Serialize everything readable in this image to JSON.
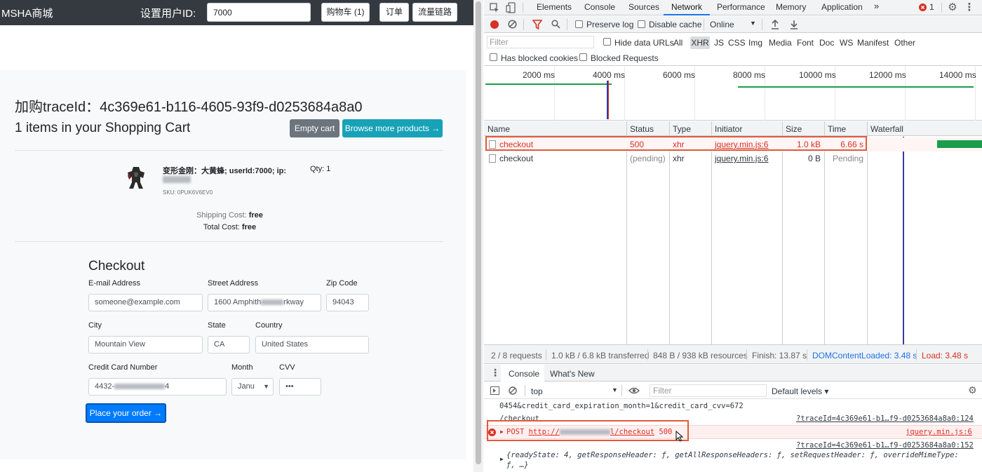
{
  "app": {
    "brand": "MSHA商城",
    "user_id_label": "设置用户ID:",
    "user_id_value": "7000",
    "cart_button": "购物车 (1)",
    "orders_button": "订单",
    "trace_button": "流量链路",
    "trace_id_text": "加购traceId：4c369e61-b116-4605-93f9-d0253684a8a0",
    "cart_count_text": "1 items in your Shopping Cart",
    "empty_cart_button": "Empty cart",
    "browse_button": "Browse more products →",
    "product": {
      "name": "变形金刚：大黄蜂; userId:7000; ip:",
      "sku": "SKU: 0PUK6V6EV0",
      "qty": "Qty: 1"
    },
    "shipping_label": "Shipping Cost: ",
    "shipping_value": "free",
    "total_label": "Total Cost: ",
    "total_value": "free",
    "checkout": {
      "title": "Checkout",
      "email_label": "E-mail Address",
      "email_value": "someone@example.com",
      "street_label": "Street Address",
      "street_value_a": "1600 Amphith",
      "street_value_b": "rkway",
      "zip_label": "Zip Code",
      "zip_value": "94043",
      "city_label": "City",
      "city_value": "Mountain View",
      "state_label": "State",
      "state_value": "CA",
      "country_label": "Country",
      "country_value": "United States",
      "cc_label": "Credit Card Number",
      "cc_value_a": "4432-",
      "cc_value_b": "4",
      "month_label": "Month",
      "month_value": "Janu",
      "cvv_label": "CVV",
      "cvv_value": "•••",
      "place_order": "Place your order →"
    }
  },
  "devtools": {
    "tabs": [
      "Elements",
      "Console",
      "Sources",
      "Network",
      "Performance",
      "Memory",
      "Application"
    ],
    "more_tabs": "»",
    "error_count": "1",
    "toolbar": {
      "preserve_log": "Preserve log",
      "disable_cache": "Disable cache",
      "throttle": "Online"
    },
    "filter": {
      "placeholder": "Filter",
      "hide_data_urls": "Hide data URLs",
      "types": [
        "All",
        "XHR",
        "JS",
        "CSS",
        "Img",
        "Media",
        "Font",
        "Doc",
        "WS",
        "Manifest",
        "Other"
      ],
      "active_type": "XHR",
      "has_blocked_cookies": "Has blocked cookies",
      "blocked_requests": "Blocked Requests"
    },
    "timeline_ticks": [
      "2000 ms",
      "4000 ms",
      "6000 ms",
      "8000 ms",
      "10000 ms",
      "12000 ms",
      "14000 ms"
    ],
    "columns": [
      "Name",
      "Status",
      "Type",
      "Initiator",
      "Size",
      "Time",
      "Waterfall"
    ],
    "requests": [
      {
        "name": "checkout",
        "status": "500",
        "type": "xhr",
        "initiator": "jquery.min.js:6",
        "size": "1.0 kB",
        "time": "6.66 s"
      },
      {
        "name": "checkout",
        "status": "(pending)",
        "type": "xhr",
        "initiator": "jquery.min.js:6",
        "size": "0 B",
        "time": "Pending"
      }
    ],
    "status_bar": {
      "requests": "2 / 8 requests",
      "transferred": "1.0 kB / 6.8 kB transferred",
      "resources": "848 B / 938 kB resources",
      "finish": "Finish: 13.87 s",
      "dcl": "DOMContentLoaded: 3.48 s",
      "load": "Load: 3.48 s"
    },
    "drawer": {
      "console_tab": "Console",
      "whats_new_tab": "What's New",
      "context": "top",
      "filter_placeholder": "Filter",
      "levels": "Default levels ▾"
    },
    "console_lines": {
      "line1": "0454&credit_card_expiration_month=1&credit_card_cvv=672",
      "line2": "/checkout",
      "line2_src": "?traceId=4c369e61-b1…f9-d0253684a8a0:124",
      "err_prefix": "POST ",
      "err_url_a": "http://",
      "err_url_b": "l/checkout",
      "err_status": " 500",
      "err_src": "jquery.min.js:6",
      "line4_src": "?traceId=4c369e61-b1…f9-d0253684a8a0:152",
      "line5": "{readyState: 4, getResponseHeader: ƒ, getAllResponseHeaders: ƒ, setRequestHeader: ƒ, overrideMimeType:",
      "line6": "ƒ, …}"
    }
  }
}
